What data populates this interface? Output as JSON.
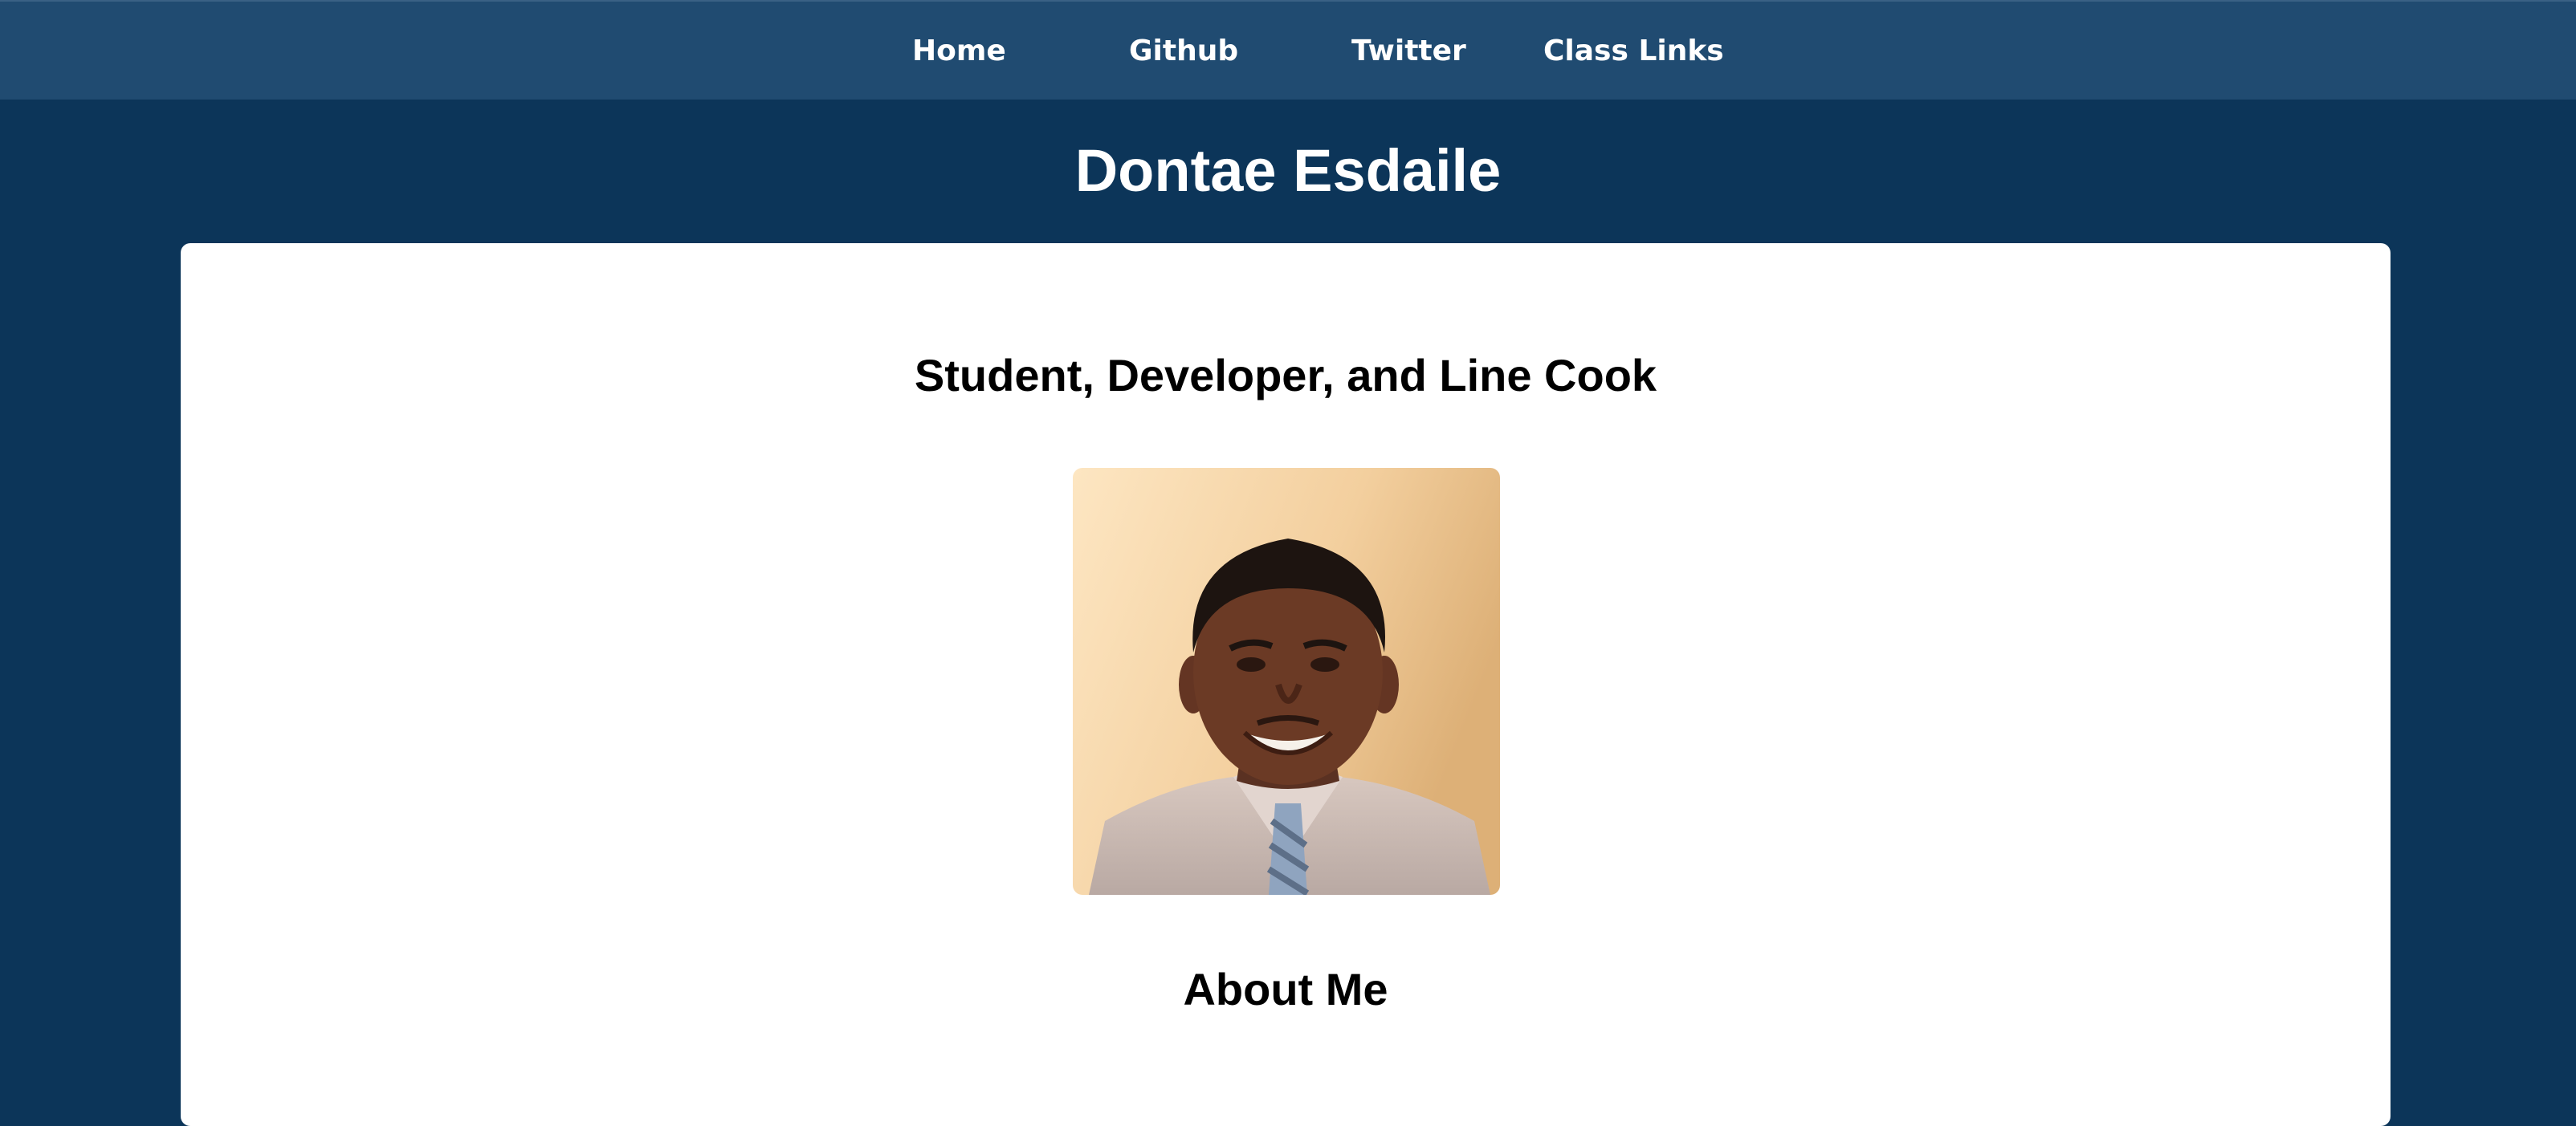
{
  "nav": {
    "items": [
      {
        "label": "Home"
      },
      {
        "label": "Github"
      },
      {
        "label": "Twitter"
      },
      {
        "label": "Class Links"
      }
    ]
  },
  "header": {
    "title": "Dontae Esdaile"
  },
  "main": {
    "tagline": "Student, Developer, and Line Cook",
    "about_heading": "About Me"
  },
  "colors": {
    "page_background": "#0c3559",
    "navbar_background": "#204b71",
    "card_background": "#ffffff",
    "text_light": "#ffffff",
    "text_dark": "#000000"
  }
}
